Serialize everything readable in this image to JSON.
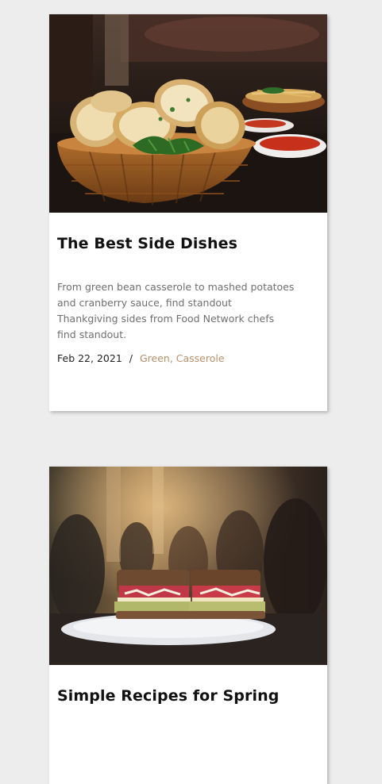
{
  "posts": [
    {
      "title": "The Best Side Dishes",
      "description": "From green bean casserole to mashed potatoes and cranberry sauce, find standout Thankgiving sides from Food Network chefs find standout.",
      "date": "Feb 22, 2021",
      "separator": "/",
      "tags": "Green, Casserole",
      "image": "garlic-bread-basket-photo"
    },
    {
      "title": "Simple Recipes for Spring",
      "image": "sandwich-restaurant-photo"
    }
  ],
  "colors": {
    "page_background": "#ededed",
    "card_background": "#ffffff",
    "tag_link": "#b8916b",
    "description_text": "#6f6f6f"
  }
}
